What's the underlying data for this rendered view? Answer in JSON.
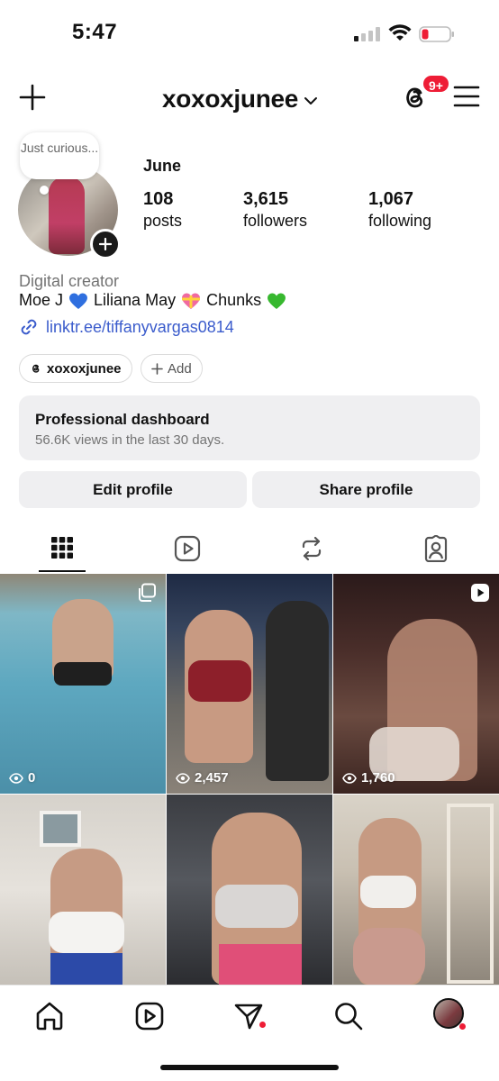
{
  "status_bar": {
    "time": "5:47"
  },
  "header": {
    "username": "xoxoxjunee",
    "notification_count": "9+",
    "icons": [
      "plus-icon",
      "chevron-down-icon",
      "threads-icon",
      "menu-icon"
    ]
  },
  "profile": {
    "note": "Just curious...",
    "display_name": "June",
    "stats": [
      {
        "value": "108",
        "label": "posts"
      },
      {
        "value": "3,615",
        "label": "followers"
      },
      {
        "value": "1,067",
        "label": "following"
      }
    ],
    "category": "Digital creator",
    "bio": {
      "part1": "Moe J",
      "part2": "Liliana May",
      "part3": "Chunks"
    },
    "link": "linktr.ee/tiffanyvargas0814",
    "threads_chip": "xoxoxjunee",
    "add_chip": "Add"
  },
  "dashboard": {
    "title": "Professional dashboard",
    "subtitle": "56.6K views in the last 30 days."
  },
  "buttons": {
    "edit_profile": "Edit profile",
    "share_profile": "Share profile"
  },
  "tabs": [
    "grid-icon",
    "reels-icon",
    "reposts-icon",
    "tagged-icon"
  ],
  "posts": [
    {
      "views": "0",
      "type": "carousel-icon"
    },
    {
      "views": "2,457",
      "type": ""
    },
    {
      "views": "1,760",
      "type": "reel-icon"
    },
    {
      "views": "",
      "type": ""
    },
    {
      "views": "",
      "type": ""
    },
    {
      "views": "",
      "type": ""
    }
  ],
  "colors": {
    "accent_link": "#3b5ccc",
    "badge_red": "#ee1d36",
    "button_bg": "#efeff1",
    "heart_blue": "#2f6fdf",
    "heart_green": "#37b82f"
  }
}
